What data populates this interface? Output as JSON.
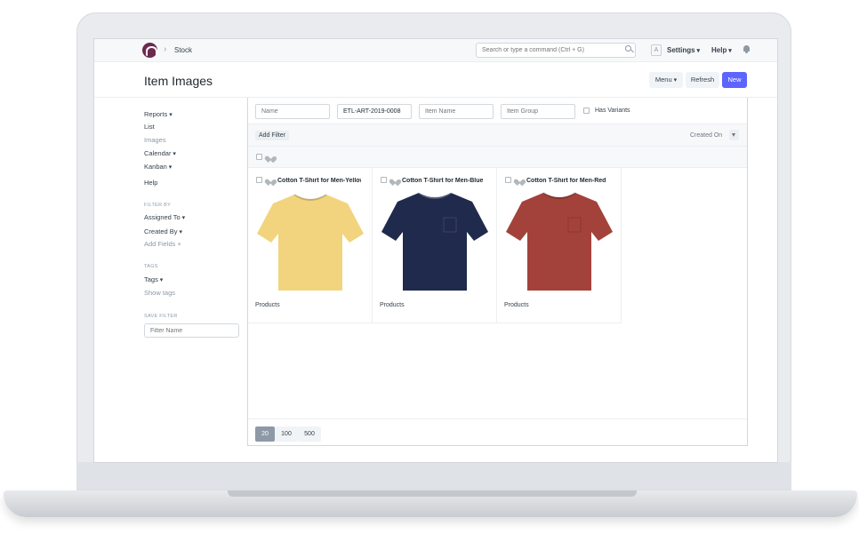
{
  "navbar": {
    "breadcrumb": "Stock",
    "search_placeholder": "Search or type a command (Ctrl + G)",
    "avatar_letter": "A",
    "settings_label": "Settings",
    "help_label": "Help"
  },
  "page": {
    "title": "Item Images",
    "menu_label": "Menu",
    "refresh_label": "Refresh",
    "new_label": "New"
  },
  "sidebar": {
    "items": [
      "Reports",
      "List",
      "Images",
      "Calendar",
      "Kanban",
      "Help"
    ],
    "filter_by_heading": "FILTER BY",
    "assigned_to": "Assigned To",
    "created_by": "Created By",
    "add_fields": "Add Fields",
    "tags_heading": "TAGS",
    "tags_label": "Tags",
    "show_tags": "Show tags",
    "save_filter_heading": "SAVE FILTER",
    "filter_name_placeholder": "Filter Name"
  },
  "filters": {
    "name_placeholder": "Name",
    "article_value": "ETL-ART-2019-0008",
    "item_name_placeholder": "Item Name",
    "item_group_placeholder": "Item Group",
    "has_variants_label": "Has Variants",
    "add_filter_label": "Add Filter",
    "sort_label": "Created On"
  },
  "cards": [
    {
      "title": "Cotton T-Shirt for Men-Yellow",
      "group": "Products",
      "color": "#f2d47e"
    },
    {
      "title": "Cotton T-Shirt for Men-Blue",
      "group": "Products",
      "color": "#202a4c"
    },
    {
      "title": "Cotton T-Shirt for Men-Red",
      "group": "Products",
      "color": "#a3423a"
    }
  ],
  "paging": {
    "options": [
      "20",
      "100",
      "500"
    ],
    "active": "20"
  }
}
